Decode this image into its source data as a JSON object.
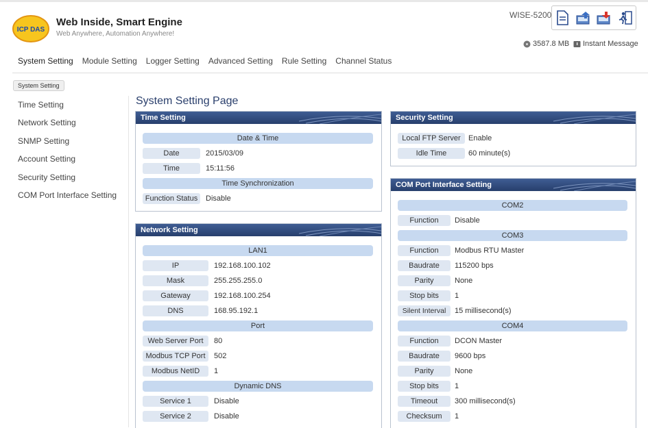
{
  "header": {
    "brand_logo_text": "ICP DAS",
    "brand_title": "Web Inside, Smart Engine",
    "brand_subtitle": "Web Anywhere, Automation Anywhere!",
    "model": "WISE-5200",
    "storage": "3587.8 MB",
    "instant_message": "Instant Message",
    "toolbar_icons": [
      "document-icon",
      "upload-icon",
      "download-icon",
      "logout-icon"
    ]
  },
  "nav": {
    "tabs": [
      "System Setting",
      "Module Setting",
      "Logger Setting",
      "Advanced Setting",
      "Rule Setting",
      "Channel Status"
    ],
    "active": "System Setting"
  },
  "breadcrumb": "System Setting",
  "sidebar": {
    "items": [
      "Time Setting",
      "Network Setting",
      "SNMP Setting",
      "Account Setting",
      "Security Setting",
      "COM Port Interface Setting"
    ]
  },
  "page_title": "System Setting Page",
  "time_setting": {
    "title": "Time Setting",
    "section1": "Date & Time",
    "date_label": "Date",
    "date_value": "2015/03/09",
    "time_label": "Time",
    "time_value": "15:11:56",
    "section2": "Time Synchronization",
    "func_label": "Function Status",
    "func_value": "Disable"
  },
  "network_setting": {
    "title": "Network Setting",
    "section_lan": "LAN1",
    "ip_label": "IP",
    "ip_value": "192.168.100.102",
    "mask_label": "Mask",
    "mask_value": "255.255.255.0",
    "gateway_label": "Gateway",
    "gateway_value": "192.168.100.254",
    "dns_label": "DNS",
    "dns_value": "168.95.192.1",
    "section_port": "Port",
    "web_label": "Web Server Port",
    "web_value": "80",
    "modbus_tcp_label": "Modbus TCP Port",
    "modbus_tcp_value": "502",
    "modbus_netid_label": "Modbus NetID",
    "modbus_netid_value": "1",
    "section_ddns": "Dynamic DNS",
    "service1_label": "Service 1",
    "service1_value": "Disable",
    "service2_label": "Service 2",
    "service2_value": "Disable"
  },
  "security_setting": {
    "title": "Security Setting",
    "ftp_label": "Local FTP Server",
    "ftp_value": "Enable",
    "idle_label": "Idle Time",
    "idle_value": "60 minute(s)"
  },
  "com_setting": {
    "title": "COM Port Interface Setting",
    "com2": "COM2",
    "com2_func_label": "Function",
    "com2_func_value": "Disable",
    "com3": "COM3",
    "com3_func_label": "Function",
    "com3_func_value": "Modbus RTU Master",
    "com3_baud_label": "Baudrate",
    "com3_baud_value": "115200 bps",
    "com3_parity_label": "Parity",
    "com3_parity_value": "None",
    "com3_stop_label": "Stop bits",
    "com3_stop_value": "1",
    "com3_silent_label": "Silent Interval",
    "com3_silent_value": "15 millisecond(s)",
    "com4": "COM4",
    "com4_func_label": "Function",
    "com4_func_value": "DCON Master",
    "com4_baud_label": "Baudrate",
    "com4_baud_value": "9600 bps",
    "com4_parity_label": "Parity",
    "com4_parity_value": "None",
    "com4_stop_label": "Stop bits",
    "com4_stop_value": "1",
    "com4_timeout_label": "Timeout",
    "com4_timeout_value": "300 millisecond(s)",
    "com4_checksum_label": "Checksum",
    "com4_checksum_value": "1"
  },
  "colors": {
    "panel_header": "#2f4a7d",
    "section_bar": "#c7d9f0",
    "label_bg": "#dfe7f2",
    "title_text": "#2a3f6c"
  }
}
